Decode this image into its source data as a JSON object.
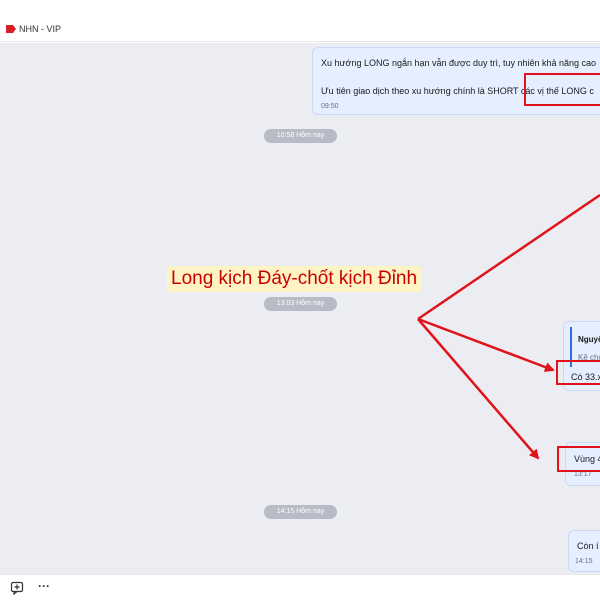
{
  "header": {
    "title": "NHN - VIP",
    "tag_color": "#d61f26",
    "tag_icon": "tag-icon"
  },
  "messages": [
    {
      "lines": [
        "Xu hướng LONG ngắn hạn vẫn được duy trì, tuy nhiên khả năng cao",
        "Ưu tiên giao dịch theo xu hướng chính là SHORT các vị thế LONG c"
      ],
      "time": "09:50"
    },
    {
      "quote_author": "Nguyê",
      "quote_text": "Kê cho",
      "text": "Có 33.x"
    },
    {
      "text": "Vùng 4",
      "time": "13:17"
    },
    {
      "text": "Còn í",
      "time": "14:15"
    }
  ],
  "dividers": [
    "10:58 Hôm nay",
    "13:03 Hôm nay",
    "14:15 Hôm nay"
  ],
  "annotation": {
    "banner_text": "Long kịch Đáy-chốt kịch Đỉnh",
    "arrow_color": "#e0131b",
    "banner_background": "#fdf3c4"
  },
  "bottom_bar": {
    "icons": [
      "add-message-icon",
      "more-options-icon"
    ],
    "more_glyph": "···"
  }
}
